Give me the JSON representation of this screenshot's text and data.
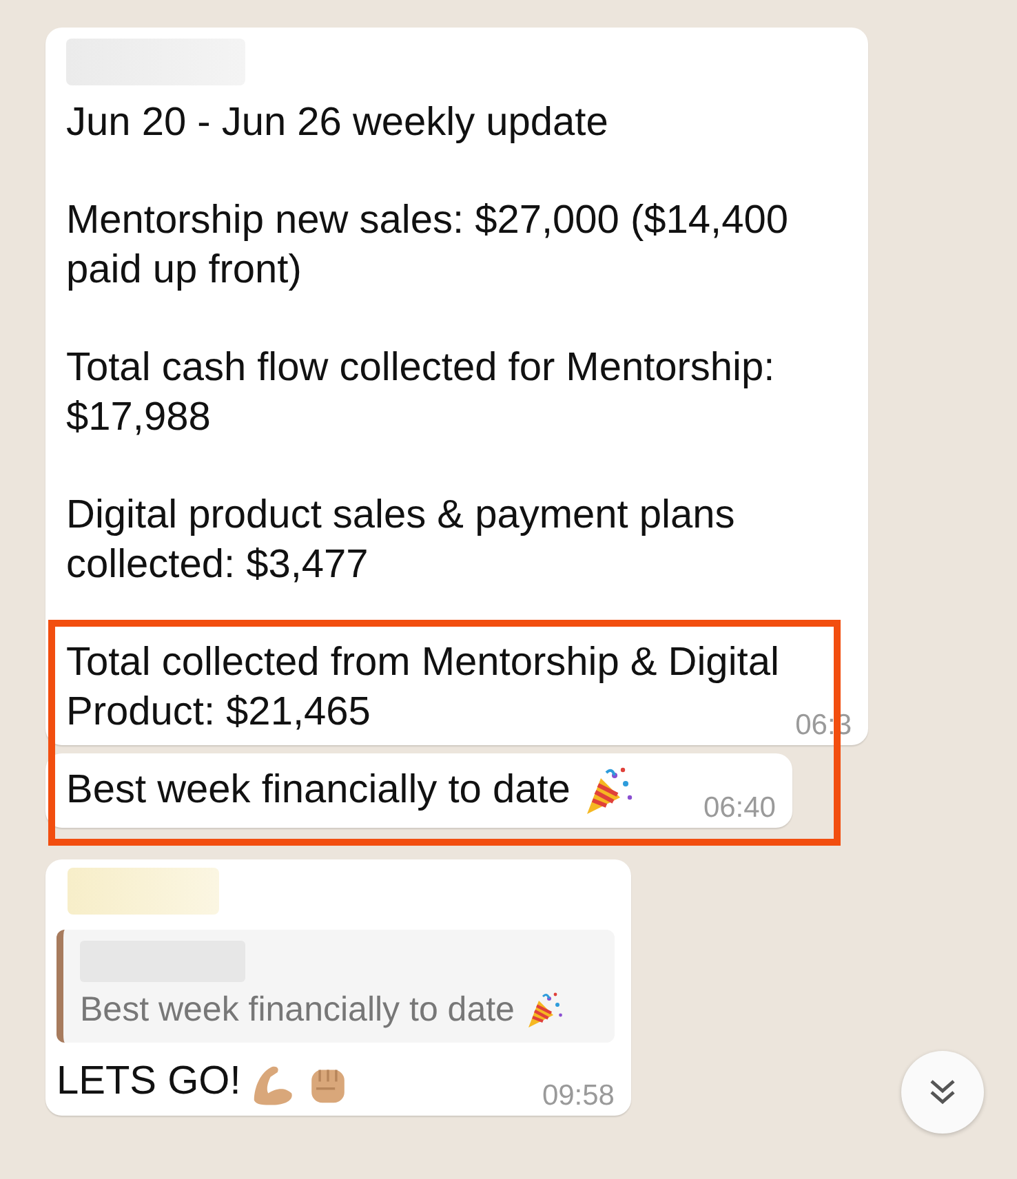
{
  "messages": [
    {
      "kind": "text",
      "sender_blurred": true,
      "paragraphs": [
        "Jun 20 - Jun 26 weekly update",
        "Mentorship new sales: $27,000 ($14,400 paid up front)",
        "Total cash flow collected for Mentorship: $17,988",
        "Digital product sales & payment plans collected: $3,477",
        "Total collected from Mentorship & Digital Product: $21,465"
      ],
      "time": "06:3"
    },
    {
      "kind": "text",
      "sender_blurred": false,
      "paragraphs": [
        "Best week financially to date"
      ],
      "time": "06:40"
    },
    {
      "kind": "reply",
      "sender_blurred": true,
      "quote": {
        "sender_blurred": true,
        "text": "Best week financially to date"
      },
      "paragraphs": [
        "LETS GO!"
      ],
      "time": "09:58"
    }
  ],
  "annotation": {
    "kind": "box"
  }
}
